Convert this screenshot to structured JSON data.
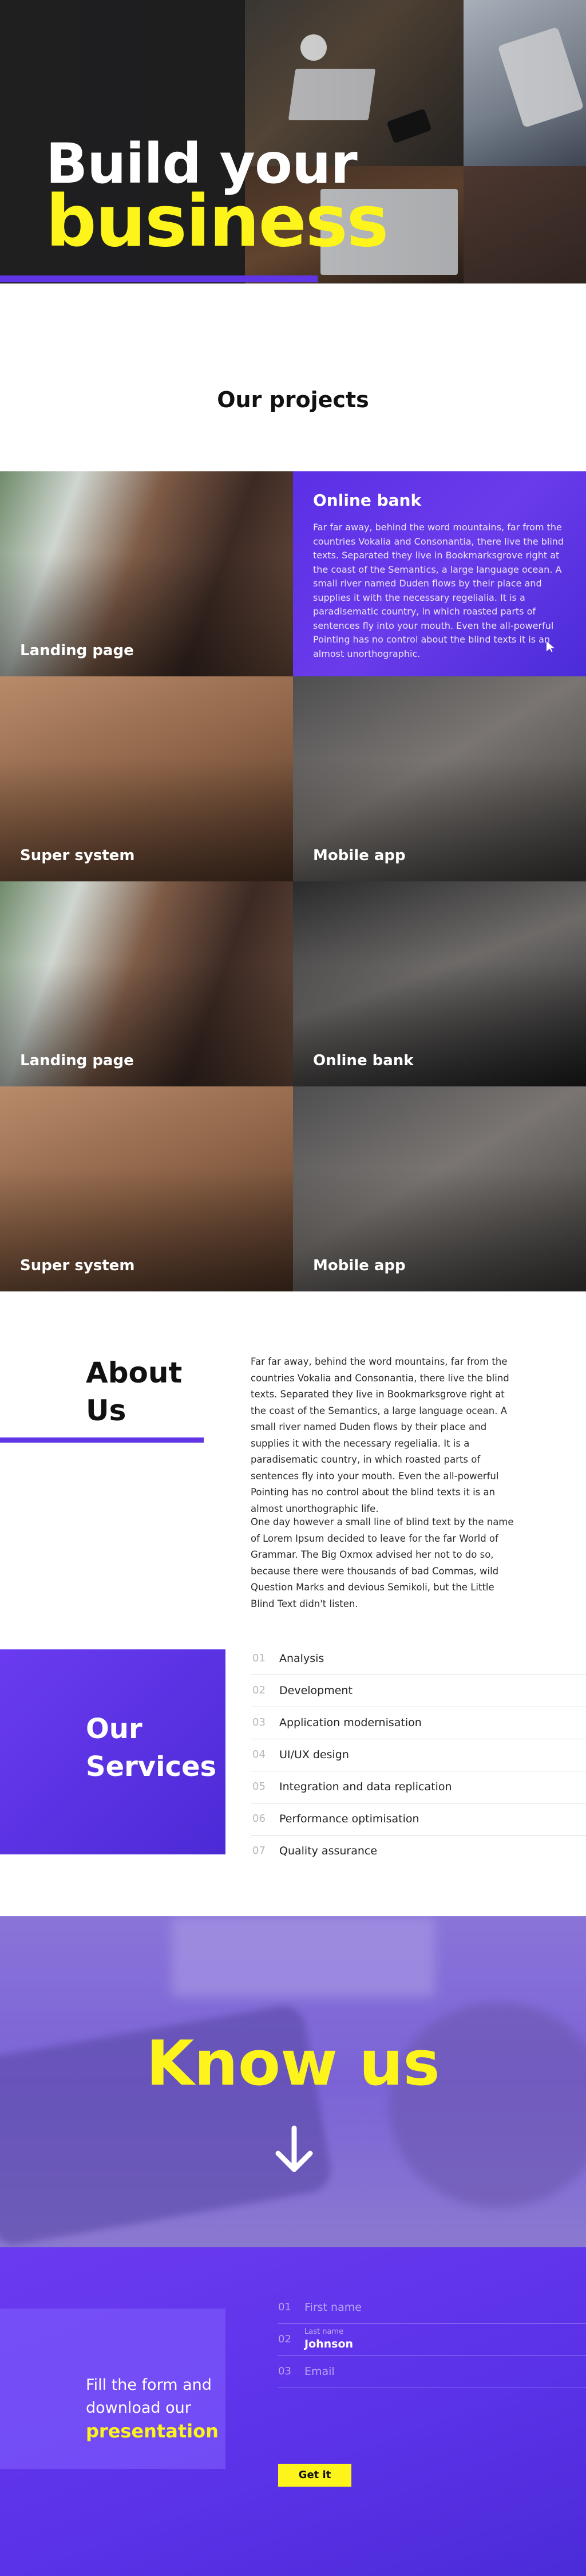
{
  "hero": {
    "title_line1": "Build your",
    "title_line2": "business"
  },
  "projects": {
    "heading": "Our projects",
    "active": {
      "title": "Online bank",
      "description": "Far far away, behind the word mountains, far from the countries Vokalia and Consonantia, there live the blind texts. Separated they live in Bookmarksgrove right at the coast of the Semantics, a large language ocean. A small river named Duden flows by their place and supplies it with the necessary regelialia. It is a paradisematic country, in which roasted parts of sentences fly into your mouth. Even the all-powerful Pointing has no control about the blind texts it is an almost unorthographic."
    },
    "tiles": [
      "Landing page",
      "Super system",
      "Mobile app",
      "Landing page",
      "Online bank",
      "Super system",
      "Mobile app"
    ]
  },
  "about": {
    "title": "About Us",
    "paragraph1": "Far far away, behind the word mountains, far from the countries Vokalia and Consonantia, there live the blind texts. Separated they live in Bookmarksgrove right at the coast of the Semantics, a large language ocean. A small river named Duden flows by their place and supplies it with the necessary regelialia. It is a paradisematic country, in which roasted parts of sentences fly into your mouth. Even the all-powerful Pointing has no control about the blind texts it is an almost unorthographic life.",
    "paragraph2": "One day however a small line of blind text by the name of Lorem Ipsum decided to leave for the far World of Grammar. The Big Oxmox advised her not to do so, because there were thousands of bad Commas, wild Question Marks and devious Semikoli, but the Little Blind Text didn't listen."
  },
  "services": {
    "title": "Our Services",
    "items": [
      {
        "num": "01",
        "label": "Analysis"
      },
      {
        "num": "02",
        "label": "Development"
      },
      {
        "num": "03",
        "label": "Application modernisation"
      },
      {
        "num": "04",
        "label": "UI/UX design"
      },
      {
        "num": "05",
        "label": "Integration and data replication"
      },
      {
        "num": "06",
        "label": "Performance optimisation"
      },
      {
        "num": "07",
        "label": "Quality assurance"
      }
    ]
  },
  "know": {
    "title": "Know us",
    "arrow_icon": "arrow-down-icon"
  },
  "form": {
    "lead_line1": "Fill the form and",
    "lead_line2": "download our",
    "lead_highlight": "presentation",
    "fields": [
      {
        "num": "01",
        "placeholder": "First name",
        "label": "",
        "value": ""
      },
      {
        "num": "02",
        "placeholder": "",
        "label": "Last name",
        "value": "Johnson"
      },
      {
        "num": "03",
        "placeholder": "Email",
        "label": "",
        "value": ""
      }
    ],
    "submit_label": "Get it"
  },
  "colors": {
    "accent_purple": "#5f35e6",
    "accent_yellow": "#fcf41b"
  }
}
